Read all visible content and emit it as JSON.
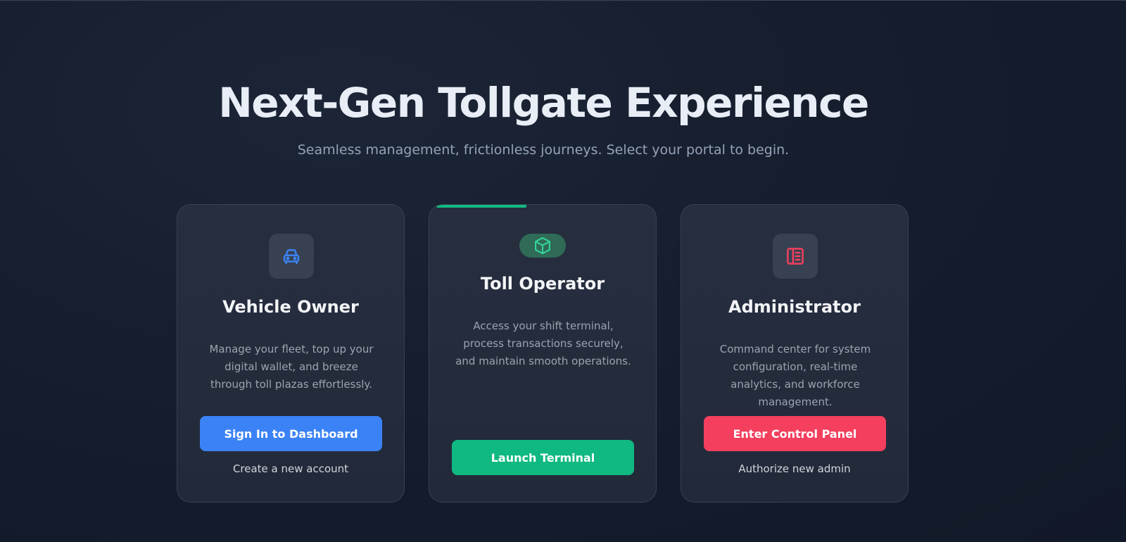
{
  "hero": {
    "title": "Next-Gen Tollgate Experience",
    "subtitle": "Seamless management, frictionless journeys. Select your portal to begin."
  },
  "cards": [
    {
      "icon": "car-icon",
      "title": "Vehicle Owner",
      "description": "Manage your fleet, top up your digital wallet, and breeze through toll plazas effortlessly.",
      "button_label": "Sign In to Dashboard",
      "link_label": "Create a new account",
      "accent_color": "#3b82f6"
    },
    {
      "icon": "cube-icon",
      "title": "Toll Operator",
      "description": "Access your shift terminal, process transactions securely, and maintain smooth operations.",
      "button_label": "Launch Terminal",
      "accent_color": "#10b981"
    },
    {
      "icon": "panel-icon",
      "title": "Administrator",
      "description": "Command center for system configuration, real-time analytics, and workforce management.",
      "button_label": "Enter Control Panel",
      "link_label": "Authorize new admin",
      "accent_color": "#f43f5e"
    }
  ]
}
